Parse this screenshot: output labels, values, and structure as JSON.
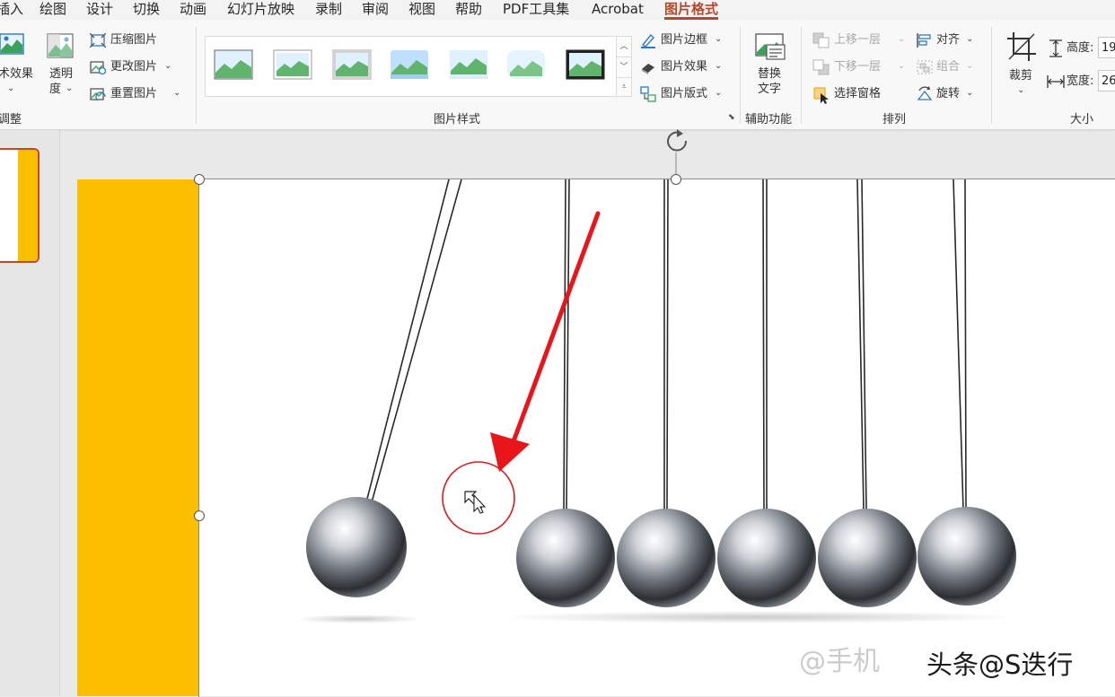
{
  "tabs": [
    "插入",
    "绘图",
    "设计",
    "切换",
    "动画",
    "幻灯片放映",
    "录制",
    "审阅",
    "视图",
    "帮助",
    "PDF工具集",
    "Acrobat",
    "图片格式"
  ],
  "adjust": {
    "artistic_effects": "术效果",
    "transparency_1": "透明",
    "transparency_2": "度",
    "compress": "压缩图片",
    "change": "更改图片",
    "reset": "重置图片",
    "group_label": "调整"
  },
  "styles": {
    "border": "图片边框",
    "effects": "图片效果",
    "layout": "图片版式",
    "group_label": "图片样式"
  },
  "accessibility": {
    "alt_text_1": "替换",
    "alt_text_2": "文字",
    "group_label": "辅助功能"
  },
  "arrange": {
    "bring_forward": "上移一层",
    "send_backward": "下移一层",
    "selection_pane": "选择窗格",
    "align": "对齐",
    "group": "组合",
    "rotate": "旋转",
    "group_label": "排列"
  },
  "size": {
    "crop": "裁剪",
    "height_label": "高度:",
    "height_value": "19",
    "width_label": "宽度:",
    "width_value": "26",
    "group_label": "大小"
  },
  "watermark": "@手机",
  "watermark2": "头条@S迭行",
  "colors": {
    "accent": "#b7472a",
    "slide_yellow": "#fbbf00",
    "arrow_red": "#e8151b"
  }
}
